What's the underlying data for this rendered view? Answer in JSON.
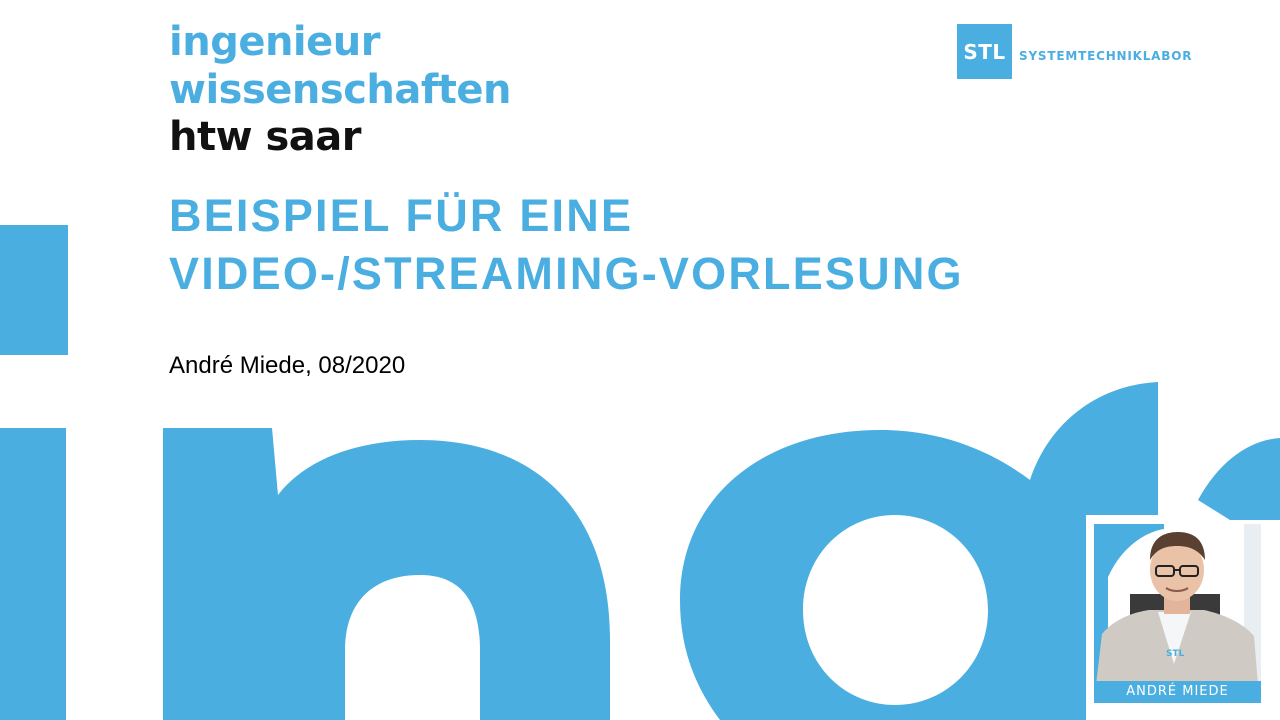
{
  "header": {
    "faculty_line1": "ingenieur",
    "faculty_line2": "wissenschaften",
    "university": "htw saar"
  },
  "lab_logo": {
    "abbr": "STL",
    "name": "SYSTEMTECHNIKLABOR"
  },
  "title": {
    "line1": "BEISPIEL FÜR EINE",
    "line2": "VIDEO-/STREAMING-VORLESUNG"
  },
  "author_line": "André Miede, 08/2020",
  "webcam": {
    "name_label": "ANDRÉ MIEDE",
    "shirt_logo": "STL"
  },
  "colors": {
    "accent": "#4aaee0",
    "text": "#000000",
    "background": "#ffffff"
  }
}
